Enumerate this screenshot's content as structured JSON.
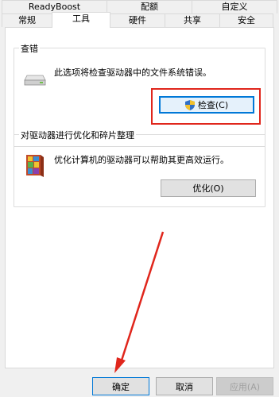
{
  "tabs_row1": [
    {
      "label": "ReadyBoost"
    },
    {
      "label": "配额"
    },
    {
      "label": "自定义"
    }
  ],
  "tabs_row2": [
    {
      "label": "常规"
    },
    {
      "label": "工具"
    },
    {
      "label": "硬件"
    },
    {
      "label": "共享"
    },
    {
      "label": "安全"
    }
  ],
  "error_check": {
    "title": "查错",
    "description": "此选项将检查驱动器中的文件系统错误。",
    "button_label": "检查(C)",
    "icon": "drive-icon",
    "button_icon": "shield-icon"
  },
  "optimize": {
    "title": "对驱动器进行优化和碎片整理",
    "description": "优化计算机的驱动器可以帮助其更高效运行。",
    "button_label": "优化(O)",
    "icon": "defrag-icon"
  },
  "footer": {
    "ok_label": "确定",
    "cancel_label": "取消",
    "apply_label": "应用(A)"
  },
  "colors": {
    "annotation_red": "#e0261c",
    "focus_blue": "#0078d7"
  }
}
